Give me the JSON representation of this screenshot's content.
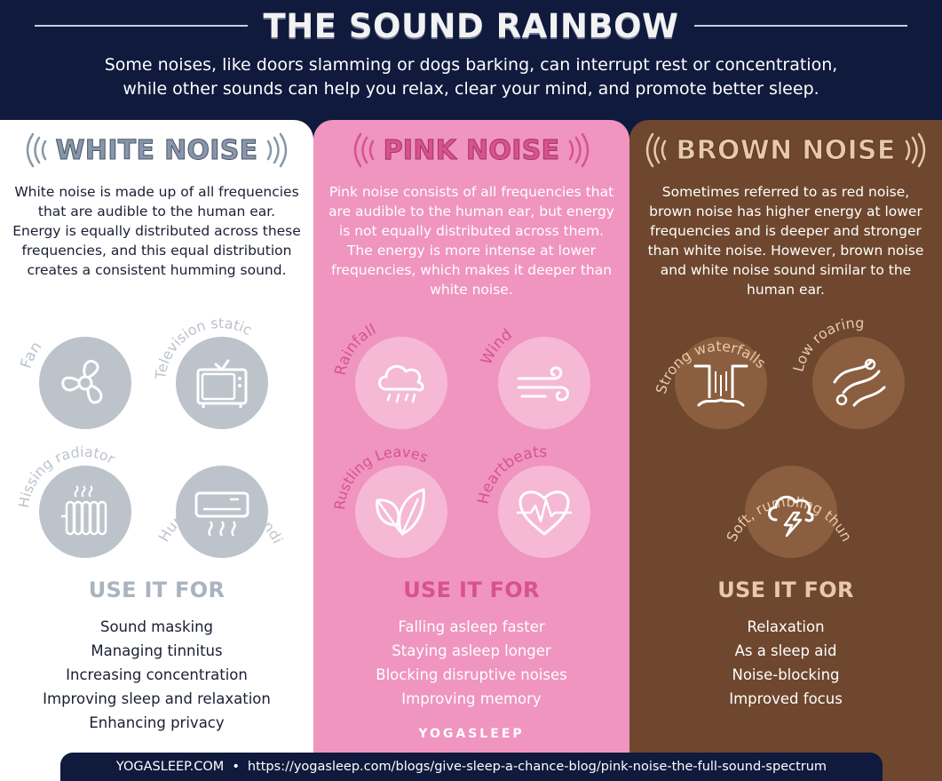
{
  "header": {
    "title": "THE SOUND RAINBOW",
    "intro_line1": "Some noises, like doors slamming or dogs barking, can interrupt rest or concentration,",
    "intro_line2": "while other sounds can help you relax, clear your mind, and promote better sleep."
  },
  "colors": {
    "background": "#0f1a3d",
    "white_panel": "#ffffff",
    "white_accent": "#8796aa",
    "white_circle": "#bcc3cb",
    "pink_panel": "#ef95bf",
    "pink_accent": "#d8528e",
    "pink_circle": "#f5b9d5",
    "brown_panel": "#6e472e",
    "brown_accent": "#e8c9a8",
    "brown_circle": "#8a5e3e"
  },
  "white": {
    "heading": "WHITE NOISE",
    "description": "White noise is made up of all frequencies that are audible to the human ear. Energy is equally distributed across these frequencies, and this equal distribution creates a consistent humming sound.",
    "examples": [
      {
        "label": "Fan",
        "icon": "fan-icon"
      },
      {
        "label": "Television static",
        "icon": "television-icon"
      },
      {
        "label": "Hissing radiator",
        "icon": "radiator-icon"
      },
      {
        "label": "Humming air conditioner",
        "icon": "air-conditioner-icon"
      }
    ],
    "use_title": "USE IT FOR",
    "uses": [
      "Sound masking",
      "Managing tinnitus",
      "Increasing concentration",
      "Improving sleep and relaxation",
      "Enhancing privacy"
    ]
  },
  "pink": {
    "heading": "PINK NOISE",
    "description": "Pink noise consists of all frequencies that are audible to the human ear, but energy is not equally distributed across them. The energy is more intense at lower frequencies, which makes it deeper than white noise.",
    "examples": [
      {
        "label": "Rainfall",
        "icon": "rain-cloud-icon"
      },
      {
        "label": "Wind",
        "icon": "wind-icon"
      },
      {
        "label": "Rustling Leaves",
        "icon": "leaves-icon"
      },
      {
        "label": "Heartbeats",
        "icon": "heartbeat-icon"
      }
    ],
    "use_title": "USE IT FOR",
    "uses": [
      "Falling asleep faster",
      "Staying asleep longer",
      "Blocking disruptive noises",
      "Improving memory"
    ],
    "brand": "YOGASLEEP"
  },
  "brown": {
    "heading": "BROWN NOISE",
    "description": "Sometimes referred to as red noise, brown noise has higher energy at lower frequencies and is deeper and stronger than white noise. However, brown noise and white noise sound similar to the human ear.",
    "examples": [
      {
        "label": "Strong waterfalls",
        "icon": "waterfall-icon"
      },
      {
        "label": "Low roaring",
        "icon": "river-icon"
      },
      {
        "label": "Soft, rumbling thunder",
        "icon": "thunder-cloud-icon"
      }
    ],
    "use_title": "USE IT FOR",
    "uses": [
      "Relaxation",
      "As a sleep aid",
      "Noise-blocking",
      "Improved focus"
    ]
  },
  "footer": {
    "site": "YOGASLEEP.COM",
    "separator": "•",
    "url": "https://yogasleep.com/blogs/give-sleep-a-chance-blog/pink-noise-the-full-sound-spectrum"
  }
}
